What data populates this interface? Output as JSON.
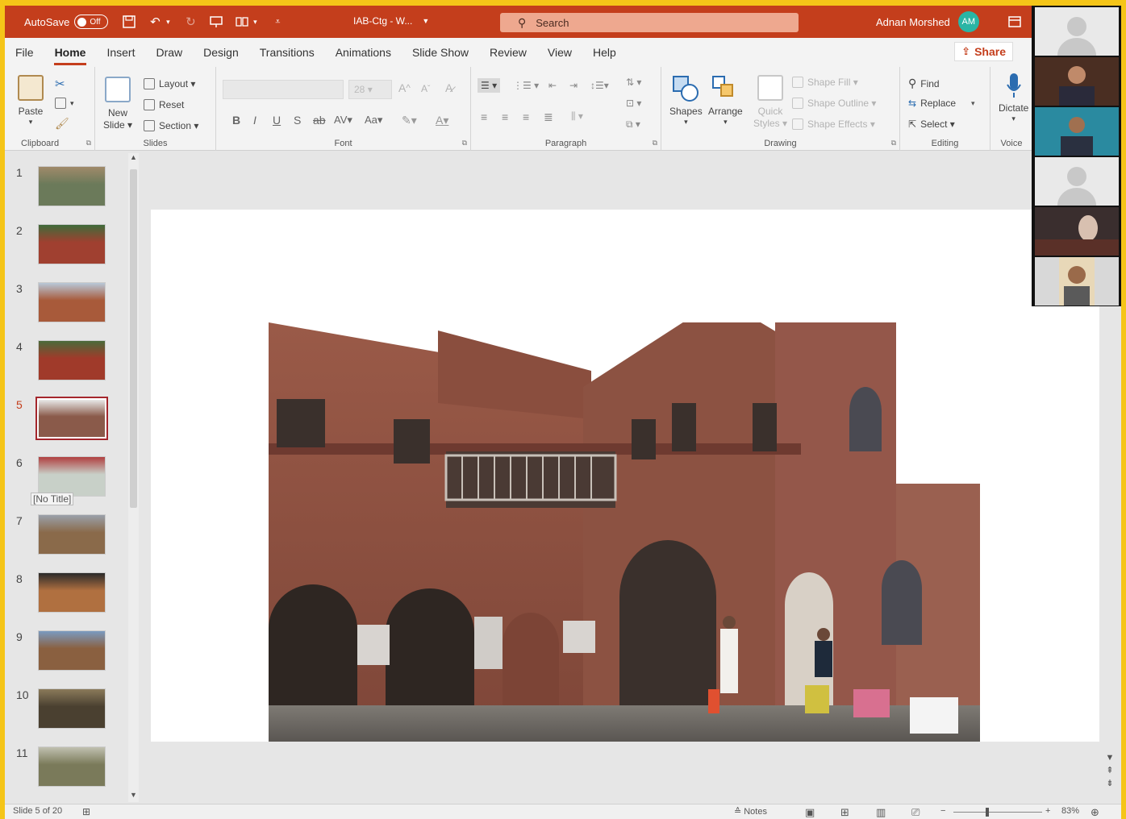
{
  "titlebar": {
    "autosave_label": "AutoSave",
    "autosave_state": "Off",
    "doc_title": "IAB-Ctg - W...",
    "search_placeholder": "Search",
    "user_name": "Adnan Morshed",
    "user_initials": "AM"
  },
  "tabs": [
    "File",
    "Home",
    "Insert",
    "Draw",
    "Design",
    "Transitions",
    "Animations",
    "Slide Show",
    "Review",
    "View",
    "Help"
  ],
  "active_tab": "Home",
  "share_label": "Share",
  "ribbon": {
    "clipboard": {
      "paste": "Paste",
      "group": "Clipboard"
    },
    "slides": {
      "new_slide_1": "New",
      "new_slide_2": "Slide",
      "layout": "Layout",
      "reset": "Reset",
      "section": "Section",
      "group": "Slides"
    },
    "font": {
      "size": "28",
      "group": "Font"
    },
    "paragraph": {
      "group": "Paragraph"
    },
    "drawing": {
      "shapes": "Shapes",
      "arrange": "Arrange",
      "quick_styles_1": "Quick",
      "quick_styles_2": "Styles",
      "shape_fill": "Shape Fill",
      "shape_outline": "Shape Outline",
      "shape_effects": "Shape Effects",
      "group": "Drawing"
    },
    "editing": {
      "find": "Find",
      "replace": "Replace",
      "select": "Select",
      "group": "Editing"
    },
    "voice": {
      "dictate": "Dictate",
      "group": "Voice"
    }
  },
  "slides": [
    {
      "num": "1",
      "colors": [
        "#6b7a5a",
        "#a08a6a"
      ]
    },
    {
      "num": "2",
      "colors": [
        "#a04030",
        "#3f6b3a"
      ]
    },
    {
      "num": "3",
      "colors": [
        "#a85a3a",
        "#b8c8d8"
      ]
    },
    {
      "num": "4",
      "colors": [
        "#a03a2a",
        "#4a6a3a"
      ]
    },
    {
      "num": "5",
      "colors": [
        "#8a5a4a",
        "#e8e8e8"
      ]
    },
    {
      "num": "6",
      "colors": [
        "#c8d0c8",
        "#b04040"
      ]
    },
    {
      "num": "7",
      "colors": [
        "#8a6a4a",
        "#9aa0aa"
      ]
    },
    {
      "num": "8",
      "colors": [
        "#b07040",
        "#2a2a2a"
      ]
    },
    {
      "num": "9",
      "colors": [
        "#8a6040",
        "#7a9ac0"
      ]
    },
    {
      "num": "10",
      "colors": [
        "#4a4030",
        "#8a7a5a"
      ]
    },
    {
      "num": "11",
      "colors": [
        "#7a7a5a",
        "#c0c0b0"
      ]
    }
  ],
  "selected_slide": "5",
  "hover_tooltip": "[No Title]",
  "status": {
    "slide_info": "Slide 5 of 20",
    "notes": "Notes",
    "zoom": "83%"
  },
  "colors": {
    "accent": "#c43e1c",
    "selected_thumb_border": "#a4262c",
    "frame": "#f5c518"
  }
}
